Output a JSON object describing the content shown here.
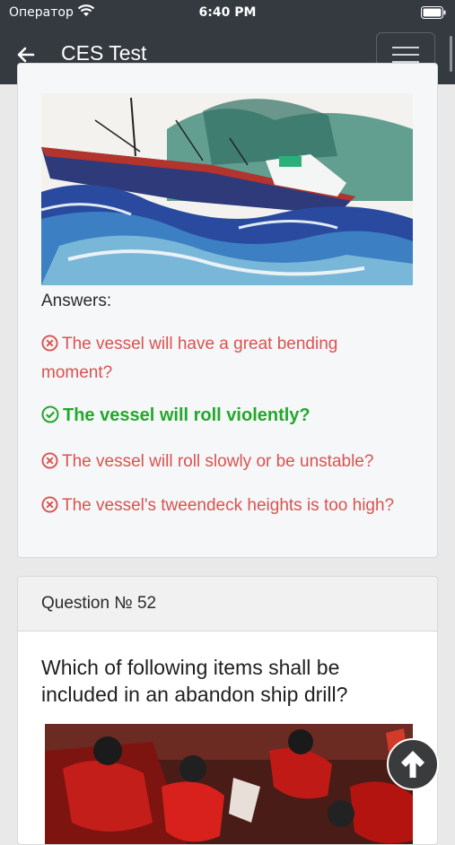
{
  "status_bar": {
    "carrier": "Оператор",
    "time": "6:40 PM",
    "wifi_icon": "wifi-icon",
    "battery_icon": "battery-icon"
  },
  "navbar": {
    "title": "CES Test",
    "back_icon": "arrow-left-icon",
    "menu_icon": "hamburger-menu-icon",
    "color": "#343a40"
  },
  "question_51": {
    "answers_label": "Answers:",
    "answers": [
      {
        "text": "The vessel will have a great bending moment?",
        "correct": false
      },
      {
        "text": "The vessel will roll violently?",
        "correct": true
      },
      {
        "text": "The vessel will roll slowly or be unstable?",
        "correct": false
      },
      {
        "text": "The vessel's tweendeck heights is too high?",
        "correct": false
      }
    ]
  },
  "question_52": {
    "header": "Question № 52",
    "text": "Which of following items shall be included in an abandon ship drill?"
  },
  "colors": {
    "wrong": "#d9534f",
    "correct": "#22a82a"
  },
  "scroll_top_icon": "arrow-up-circle-icon"
}
